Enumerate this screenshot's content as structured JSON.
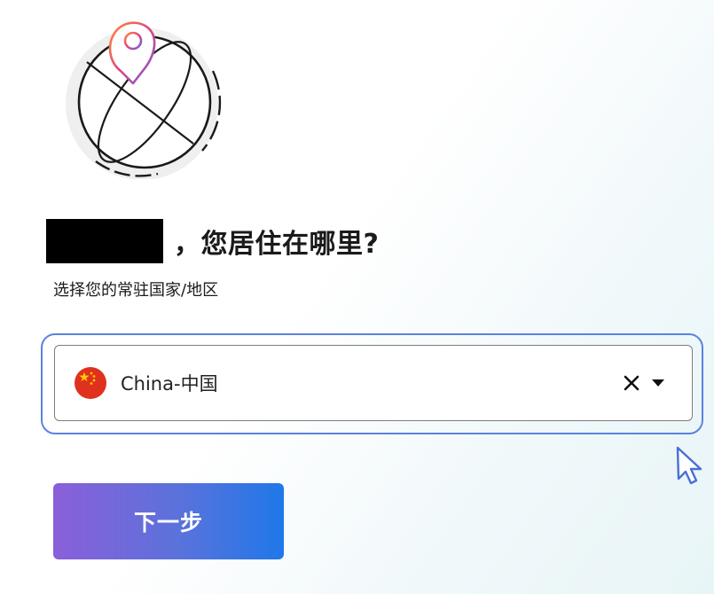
{
  "header": {
    "icon": "globe-location-icon",
    "title_suffix": "，您居住在哪里?",
    "subtitle": "选择您的常驻国家/地区"
  },
  "country_select": {
    "value": "China-中国",
    "flag_icon": "china-flag-icon",
    "clear_icon": "close-icon",
    "dropdown_icon": "caret-down-icon",
    "focus_color": "#5b82e0"
  },
  "actions": {
    "next_label": "下一步",
    "gradient_start": "#8b5fd9",
    "gradient_end": "#1f78e8"
  }
}
